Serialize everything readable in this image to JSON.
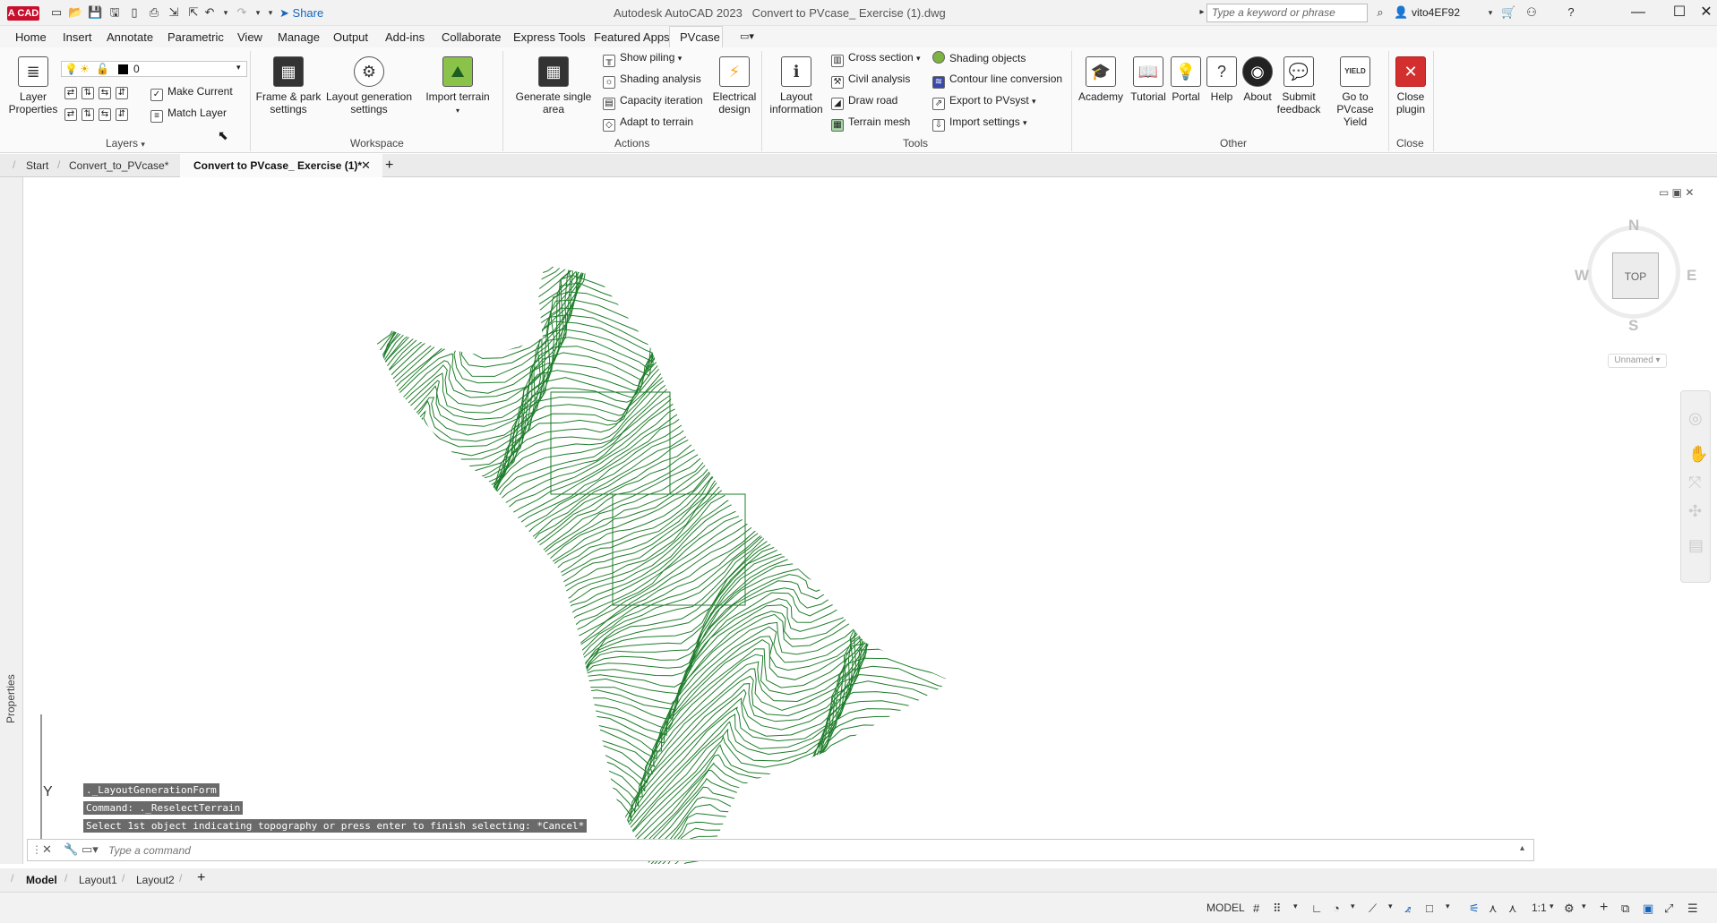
{
  "app": {
    "badge": "A CAD",
    "title": "Autodesk AutoCAD 2023",
    "file": "Convert to PVcase_ Exercise (1).dwg",
    "share_label": "Share",
    "search_placeholder": "Type a keyword or phrase",
    "username": "vito4EF92"
  },
  "ribbon_tabs": [
    "Home",
    "Insert",
    "Annotate",
    "Parametric",
    "View",
    "Manage",
    "Output",
    "Add-ins",
    "Collaborate",
    "Express Tools",
    "Featured Apps",
    "PVcase"
  ],
  "active_ribbon_tab": "PVcase",
  "panels": {
    "layers": {
      "title": "Layers",
      "layer_properties": "Layer Properties",
      "current_layer": "0",
      "make_current": "Make Current",
      "match_layer": "Match Layer"
    },
    "workspace": {
      "title": "Workspace",
      "frame_park": "Frame & park settings",
      "layout_generation": "Layout generation settings",
      "import_terrain": "Import terrain"
    },
    "actions": {
      "title": "Actions",
      "generate_single_area": "Generate single area",
      "show_piling": "Show piling",
      "shading_analysis": "Shading analysis",
      "capacity_iteration": "Capacity iteration",
      "adapt_to_terrain": "Adapt to terrain",
      "electrical_design": "Electrical design"
    },
    "tools": {
      "title": "Tools",
      "layout_information": "Layout information",
      "cross_section": "Cross section",
      "civil_analysis": "Civil analysis",
      "draw_road": "Draw road",
      "terrain_mesh": "Terrain mesh",
      "shading_objects": "Shading objects",
      "contour_line_conversion": "Contour line conversion",
      "export_to_pvsyst": "Export to PVsyst",
      "import_settings": "Import settings"
    },
    "other": {
      "title": "Other",
      "academy": "Academy",
      "tutorial": "Tutorial",
      "portal": "Portal",
      "help": "Help",
      "about": "About",
      "submit_feedback": "Submit feedback",
      "go_to_yield": "Go to PVcase Yield",
      "yield_badge": "YIELD"
    },
    "close": {
      "title": "Close",
      "close_plugin": "Close plugin"
    }
  },
  "doc_tabs": [
    "Start",
    "Convert_to_PVcase*",
    "Convert to PVcase_ Exercise (1)*"
  ],
  "active_doc_tab": "Convert to PVcase_ Exercise (1)*",
  "properties_label": "Properties",
  "viewcube": {
    "north": "N",
    "south": "S",
    "east": "E",
    "west": "W",
    "face": "TOP",
    "ucs": "Unnamed"
  },
  "ucs_axis": "Y",
  "command_history": [
    "._LayoutGenerationForm",
    "Command: ._ReselectTerrain",
    "Select 1st object indicating topography or press enter to finish selecting: *Cancel*"
  ],
  "command_placeholder": "Type a command",
  "layout_tabs": [
    "Model",
    "Layout1",
    "Layout2"
  ],
  "active_layout_tab": "Model",
  "status": {
    "model": "MODEL",
    "scale": "1:1"
  },
  "colors": {
    "contour": "#1e7d2a",
    "accent": "#c8102e",
    "pvcase_close": "#d32f2f"
  }
}
